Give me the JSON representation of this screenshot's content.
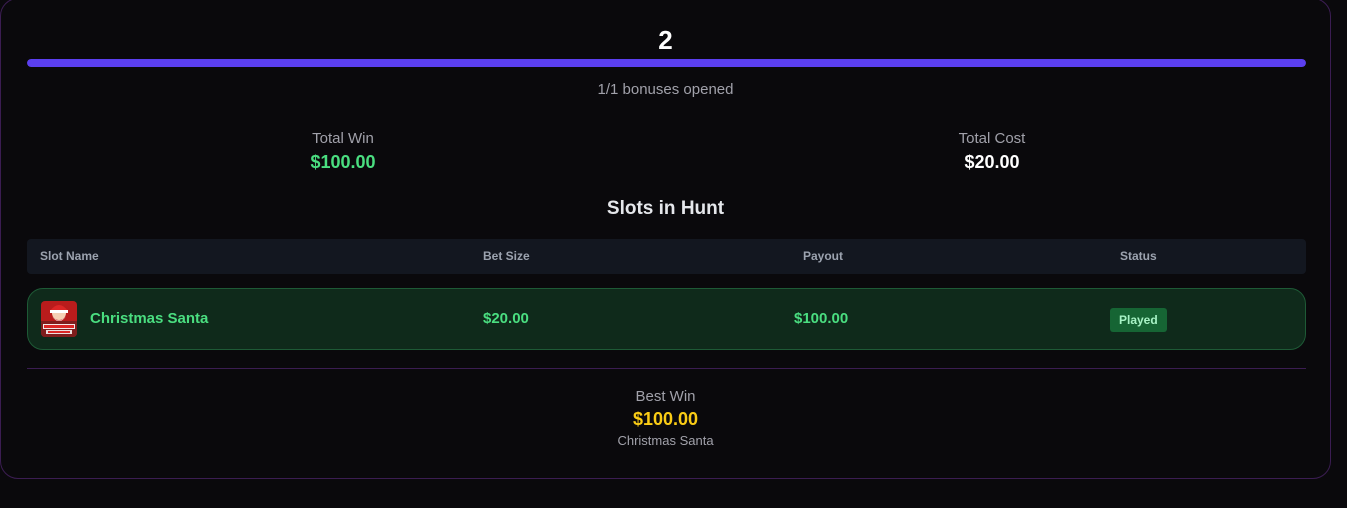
{
  "hunt": {
    "count": "2",
    "progress_fraction": 1.0,
    "bonuses_opened_text": "1/1 bonuses opened"
  },
  "stats": {
    "total_win_label": "Total Win",
    "total_win_value": "$100.00",
    "total_cost_label": "Total Cost",
    "total_cost_value": "$20.00"
  },
  "slots_section": {
    "title": "Slots in Hunt",
    "columns": [
      "Slot Name",
      "Bet Size",
      "Payout",
      "Status"
    ],
    "rows": [
      {
        "name": "Christmas Santa",
        "thumb_icon": "christmas-santa-slot-thumbnail",
        "bet_size": "$20.00",
        "payout": "$100.00",
        "status": "Played"
      }
    ]
  },
  "best_win": {
    "label": "Best Win",
    "value": "$100.00",
    "slot_name": "Christmas Santa"
  },
  "colors": {
    "accent": "#5b3ff0",
    "win_green": "#4ade80",
    "best_gold": "#facc15",
    "row_bg": "#0f2a1b",
    "status_badge_bg": "#166534"
  }
}
